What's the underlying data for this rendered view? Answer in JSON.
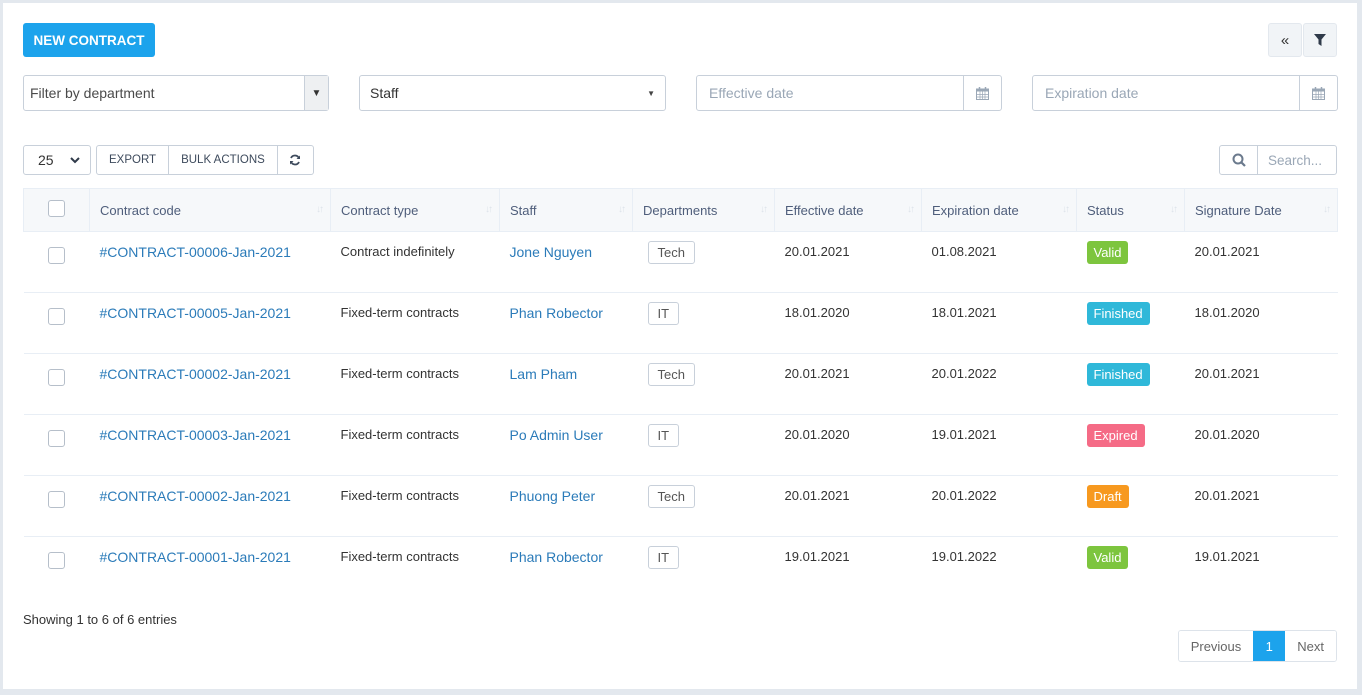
{
  "header": {
    "new_contract_label": "NEW CONTRACT",
    "collapse_icon": "double-chevron-left",
    "filter_icon": "funnel"
  },
  "filters": {
    "department_placeholder": "Filter by department",
    "staff_value": "Staff",
    "effective_date_placeholder": "Effective date",
    "expiration_date_placeholder": "Expiration date"
  },
  "toolbar": {
    "page_length": "25",
    "export_label": "EXPORT",
    "bulk_actions_label": "BULK ACTIONS",
    "search_placeholder": "Search..."
  },
  "colors": {
    "accent": "#1ca3ec",
    "link": "#2b7bb9",
    "status_valid": "#7dc53e",
    "status_finished": "#2fb8d9",
    "status_expired": "#f56b86",
    "status_draft": "#f7991f"
  },
  "table": {
    "columns": [
      "Contract code",
      "Contract type",
      "Staff",
      "Departments",
      "Effective date",
      "Expiration date",
      "Status",
      "Signature Date"
    ],
    "rows": [
      {
        "code": "#CONTRACT-00006-Jan-2021",
        "type": "Contract indefinitely",
        "staff": "Jone Nguyen",
        "dept": "Tech",
        "effective": "20.01.2021",
        "expiration": "01.08.2021",
        "status": "Valid",
        "status_color": "#7dc53e",
        "signature": "20.01.2021"
      },
      {
        "code": "#CONTRACT-00005-Jan-2021",
        "type": "Fixed-term contracts",
        "staff": "Phan Robector",
        "dept": "IT",
        "effective": "18.01.2020",
        "expiration": "18.01.2021",
        "status": "Finished",
        "status_color": "#2fb8d9",
        "signature": "18.01.2020"
      },
      {
        "code": "#CONTRACT-00002-Jan-2021",
        "type": "Fixed-term contracts",
        "staff": "Lam Pham",
        "dept": "Tech",
        "effective": "20.01.2021",
        "expiration": "20.01.2022",
        "status": "Finished",
        "status_color": "#2fb8d9",
        "signature": "20.01.2021"
      },
      {
        "code": "#CONTRACT-00003-Jan-2021",
        "type": "Fixed-term contracts",
        "staff": "Po Admin User",
        "dept": "IT",
        "effective": "20.01.2020",
        "expiration": "19.01.2021",
        "status": "Expired",
        "status_color": "#f56b86",
        "signature": "20.01.2020"
      },
      {
        "code": "#CONTRACT-00002-Jan-2021",
        "type": "Fixed-term contracts",
        "staff": "Phuong Peter",
        "dept": "Tech",
        "effective": "20.01.2021",
        "expiration": "20.01.2022",
        "status": "Draft",
        "status_color": "#f7991f",
        "signature": "20.01.2021"
      },
      {
        "code": "#CONTRACT-00001-Jan-2021",
        "type": "Fixed-term contracts",
        "staff": "Phan Robector",
        "dept": "IT",
        "effective": "19.01.2021",
        "expiration": "19.01.2022",
        "status": "Valid",
        "status_color": "#7dc53e",
        "signature": "19.01.2021"
      }
    ]
  },
  "footer": {
    "info": "Showing 1 to 6 of 6 entries",
    "previous_label": "Previous",
    "current_page": "1",
    "next_label": "Next"
  }
}
